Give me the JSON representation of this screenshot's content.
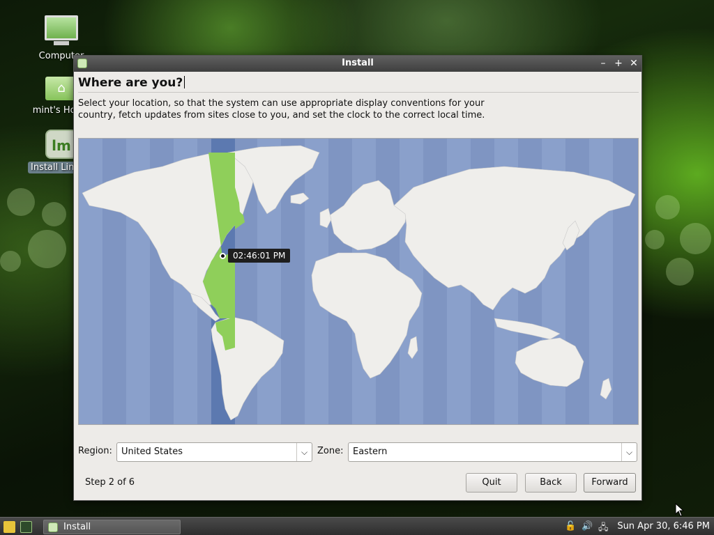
{
  "desktop": {
    "icons": [
      {
        "label": "Computer",
        "icon": "computer-icon"
      },
      {
        "label": "mint's Home",
        "icon": "home-folder-icon"
      },
      {
        "label": "Install Linux Mint",
        "icon": "mint-installer-icon"
      }
    ]
  },
  "window": {
    "title": "Install",
    "controls": [
      "minimize-icon",
      "maximize-icon",
      "close-icon"
    ]
  },
  "page": {
    "heading": "Where are you?",
    "description": "Select your location, so that the system can use appropriate display conventions for your country, fetch updates from sites close to you, and set the clock to the correct local time.",
    "tooltip_time": "02:46:01 PM",
    "region_label": "Region:",
    "region_value": "United States",
    "zone_label": "Zone:",
    "zone_value": "Eastern",
    "step": "Step 2 of 6"
  },
  "buttons": {
    "quit": "Quit",
    "back": "Back",
    "forward": "Forward"
  },
  "taskbar": {
    "task_label": "Install",
    "clock": "Sun Apr 30,  6:46 PM",
    "tray_icons": [
      "lock-icon",
      "volume-icon",
      "network-icon"
    ]
  },
  "colors": {
    "map_ocean": "#7f95c2",
    "map_land": "#efeeeb",
    "timezone_highlight": "#8fcf5a",
    "timezone_band": "#5c79b0"
  }
}
